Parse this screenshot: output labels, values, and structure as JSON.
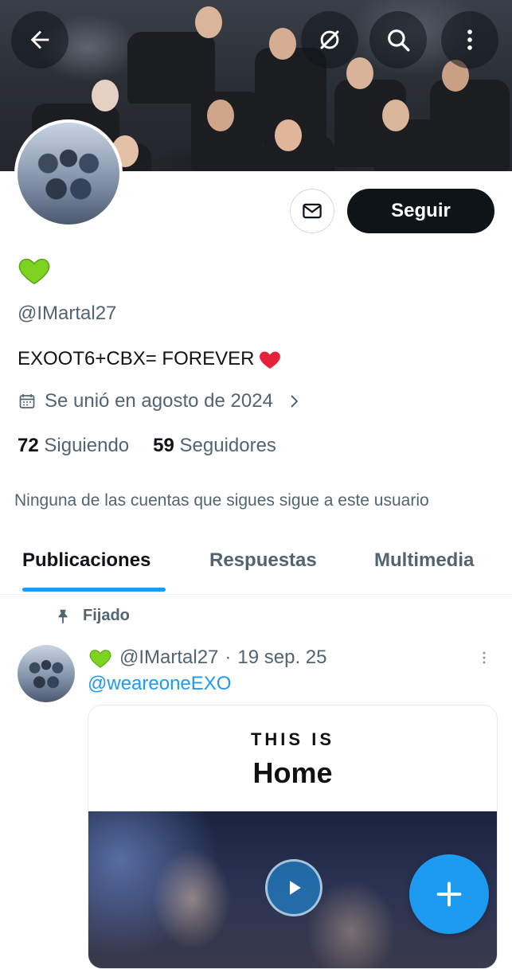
{
  "profile": {
    "handle": "@IMartal27",
    "bio": "EXOOT6+CBX= FOREVER",
    "joined": "Se unió en agosto de 2024",
    "following_count": "72",
    "following_label": "Siguiendo",
    "followers_count": "59",
    "followers_label": "Seguidores",
    "mutual_note": "Ninguna de las cuentas que sigues sigue a este usuario"
  },
  "actions": {
    "follow_label": "Seguir"
  },
  "tabs": [
    {
      "label": "Publicaciones",
      "active": true
    },
    {
      "label": "Respuestas",
      "active": false
    },
    {
      "label": "Multimedia",
      "active": false
    }
  ],
  "post": {
    "pinned_label": "Fijado",
    "handle": "@IMartal27",
    "separator": "·",
    "date": "19 sep. 25",
    "mention": "@weareoneEXO",
    "card_line1": "THIS IS",
    "card_line2": "Home"
  },
  "icons": {
    "back": "arrow-left-icon",
    "grok": "grok-icon",
    "search": "search-icon",
    "more": "more-vertical-icon",
    "message": "envelope-icon",
    "calendar": "calendar-icon",
    "chevron": "chevron-right-icon",
    "pin": "pin-icon",
    "play": "play-icon",
    "compose": "plus-icon",
    "heart_green": "green-heart-icon",
    "heart_red": "red-heart-icon"
  },
  "colors": {
    "accent": "#1d9bf0",
    "text_primary": "#0f1419",
    "text_secondary": "#536471",
    "follow_button": "#0f1419"
  }
}
